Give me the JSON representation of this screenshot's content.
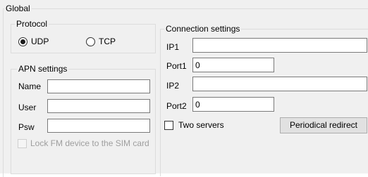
{
  "global": {
    "title": "Global",
    "protocol": {
      "title": "Protocol",
      "options": [
        {
          "label": "UDP",
          "selected": true
        },
        {
          "label": "TCP",
          "selected": false
        }
      ]
    },
    "apn": {
      "title": "APN settings",
      "fields": [
        {
          "label": "Name",
          "value": ""
        },
        {
          "label": "User",
          "value": ""
        },
        {
          "label": "Psw",
          "value": ""
        }
      ],
      "lock_checkbox": {
        "label": "Lock FM device to the SIM card",
        "checked": false,
        "enabled": false
      }
    },
    "connection": {
      "title": "Connection settings",
      "ip1": {
        "label": "IP1",
        "value": ""
      },
      "port1": {
        "label": "Port1",
        "value": "0"
      },
      "ip2": {
        "label": "IP2",
        "value": ""
      },
      "port2": {
        "label": "Port2",
        "value": "0"
      },
      "two_servers": {
        "label": "Two servers",
        "checked": false
      },
      "periodical_redirect_button": "Periodical redirect"
    }
  },
  "colors": {
    "window_background": "#f0f0f0",
    "groupbox_border": "#dcdcdc",
    "textbox_border": "#7a7a7a",
    "button_face": "#e1e1e1",
    "disabled_text": "#9e9e9e"
  }
}
